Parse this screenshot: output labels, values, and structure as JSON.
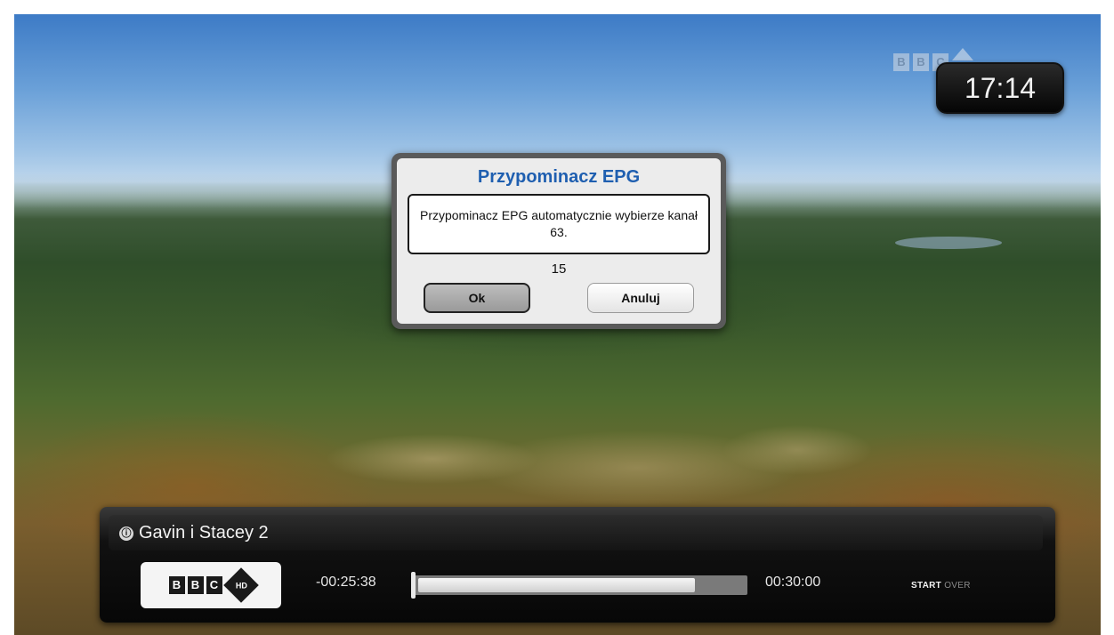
{
  "clock": {
    "time": "17:14"
  },
  "dialog": {
    "title": "Przypominacz EPG",
    "message": "Przypominacz EPG automatycznie wybierze kanał 63.",
    "countdown": "15",
    "ok_label": "Ok",
    "cancel_label": "Anuluj"
  },
  "infobar": {
    "program_title": "Gavin i Stacey 2",
    "channel_logo_text": [
      "B",
      "B",
      "C"
    ],
    "time_remaining": "-00:25:38",
    "duration": "00:30:00",
    "progress_fraction": 0.85,
    "start_over_label_1": "START",
    "start_over_label_2": "OVER"
  },
  "icons": [
    "bbc-hd-logo",
    "program-info-icon",
    "bbc-watermark-icon"
  ]
}
